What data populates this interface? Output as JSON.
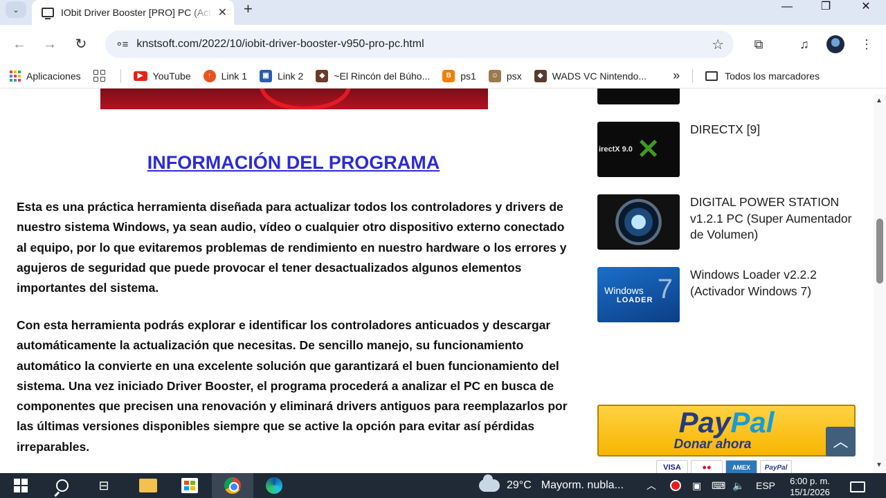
{
  "browser": {
    "tab_title": "IObit Driver Booster [PRO] PC (Actualizador de Drivers)",
    "new_tab": "+",
    "minimize": "—",
    "maximize": "❐",
    "close": "✕",
    "url": "knstsoft.com/2022/10/iobit-driver-booster-v950-pro-pc.html"
  },
  "bookmarks": {
    "items": [
      {
        "label": "Aplicaciones"
      },
      {
        "label": "YouTube"
      },
      {
        "label": "Link 1"
      },
      {
        "label": "Link 2"
      },
      {
        "label": "~El Rincón del Búho..."
      },
      {
        "label": "ps1"
      },
      {
        "label": "psx"
      },
      {
        "label": "WADS VC Nintendo..."
      }
    ],
    "overflow": "»",
    "all_bookmarks": "Todos los marcadores"
  },
  "article": {
    "section_title": "INFORMACIÓN DEL PROGRAMA",
    "paragraph_1": "Esta es una práctica herramienta diseñada para actualizar todos los controladores y drivers de nuestro sistema Windows, ya sean audio, vídeo o cualquier otro dispositivo externo conectado al equipo, por lo que evitaremos problemas de rendimiento en nuestro hardware o los errores y agujeros de seguridad que puede provocar el tener desactualizados algunos elementos importantes del sistema.",
    "paragraph_2": "Con esta herramienta podrás explorar e identificar los controladores anticuados y descargar automáticamente la actualización que necesitas. De sencillo manejo, su funcionamiento automático la convierte en una excelente solución que garantizará el buen funcionamiento del sistema. Una vez iniciado Driver Booster, el programa procederá a analizar el PC en busca de componentes que precisen una renovación y eliminará drivers antiguos para reemplazarlos por las últimas versiones disponibles siempre que se active la opción para evitar así pérdidas irreparables."
  },
  "sidebar": {
    "posts": [
      {
        "title": "DIRECTX [9]",
        "thumb_text": "irectX 9.0"
      },
      {
        "title": "DIGITAL POWER STATION v1.2.1 PC (Super Aumentador de Volumen)"
      },
      {
        "title": "Windows Loader v2.2.2 (Activador Windows 7)",
        "thumb_text_1": "Windows",
        "thumb_text_2": "LOADER"
      }
    ],
    "paypal": {
      "logo_pay": "Pay",
      "logo_pal": "Pal",
      "button_label": "Donar ahora"
    },
    "cards": [
      "VISA",
      "●●",
      "AMEX",
      "PayPal"
    ],
    "back_to_top": "︿"
  },
  "taskbar": {
    "weather_temp": "29°C",
    "weather_desc": "Mayorm. nubla...",
    "language": "ESP",
    "time": "6:00 p. m.",
    "date": "15/1/2026"
  },
  "colors": {
    "link_blue": "#2b2bd9",
    "paypal_yellow": "#ffc439",
    "taskbar": "#1f2a36"
  }
}
